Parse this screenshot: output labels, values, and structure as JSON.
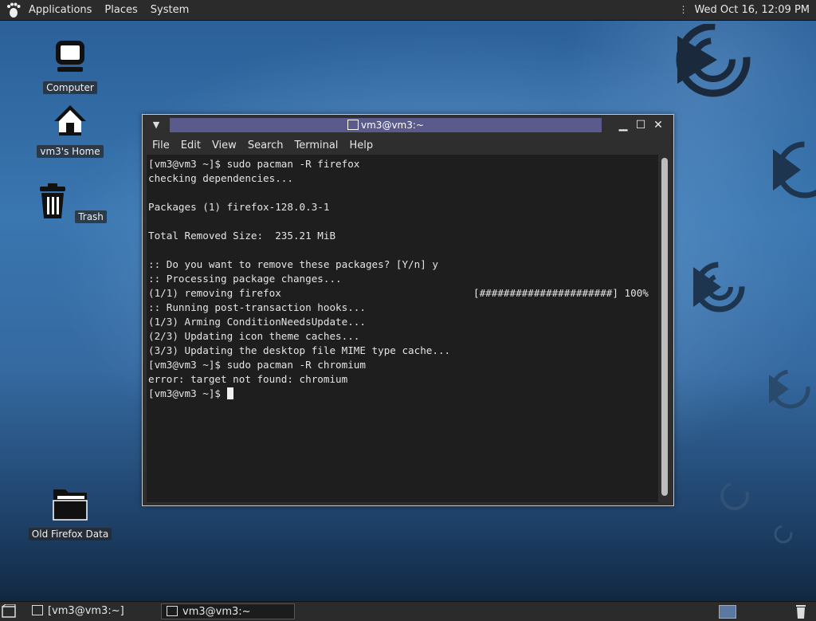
{
  "top_panel": {
    "menus": [
      "Applications",
      "Places",
      "System"
    ],
    "clock": "Wed Oct 16, 12:09 PM"
  },
  "desktop": {
    "icons": [
      {
        "label": "Computer",
        "icon": "computer-icon"
      },
      {
        "label": "vm3's Home",
        "icon": "home-icon"
      },
      {
        "label": "Trash",
        "icon": "trash-icon"
      },
      {
        "label": "Old Firefox Data",
        "icon": "folder-icon"
      }
    ]
  },
  "window": {
    "title": "vm3@vm3:~",
    "menus": [
      "File",
      "Edit",
      "View",
      "Search",
      "Terminal",
      "Help"
    ],
    "lines": [
      "[vm3@vm3 ~]$ sudo pacman -R firefox",
      "checking dependencies...",
      "",
      "Packages (1) firefox-128.0.3-1",
      "",
      "Total Removed Size:  235.21 MiB",
      "",
      ":: Do you want to remove these packages? [Y/n] y",
      ":: Processing package changes...",
      "(1/1) removing firefox",
      ":: Running post-transaction hooks...",
      "(1/3) Arming ConditionNeedsUpdate...",
      "(2/3) Updating icon theme caches...",
      "(3/3) Updating the desktop file MIME type cache...",
      "[vm3@vm3 ~]$ sudo pacman -R chromium",
      "error: target not found: chromium",
      "[vm3@vm3 ~]$ "
    ],
    "progress_text": "[######################] 100%",
    "progress_value": 100
  },
  "taskbar": {
    "tasks": [
      "[vm3@vm3:~]",
      "vm3@vm3:~"
    ]
  },
  "colors": {
    "title_bg": "#5a5a8c",
    "terminal_bg": "#1e1e1e",
    "panel_bg": "#2b2b2b"
  }
}
